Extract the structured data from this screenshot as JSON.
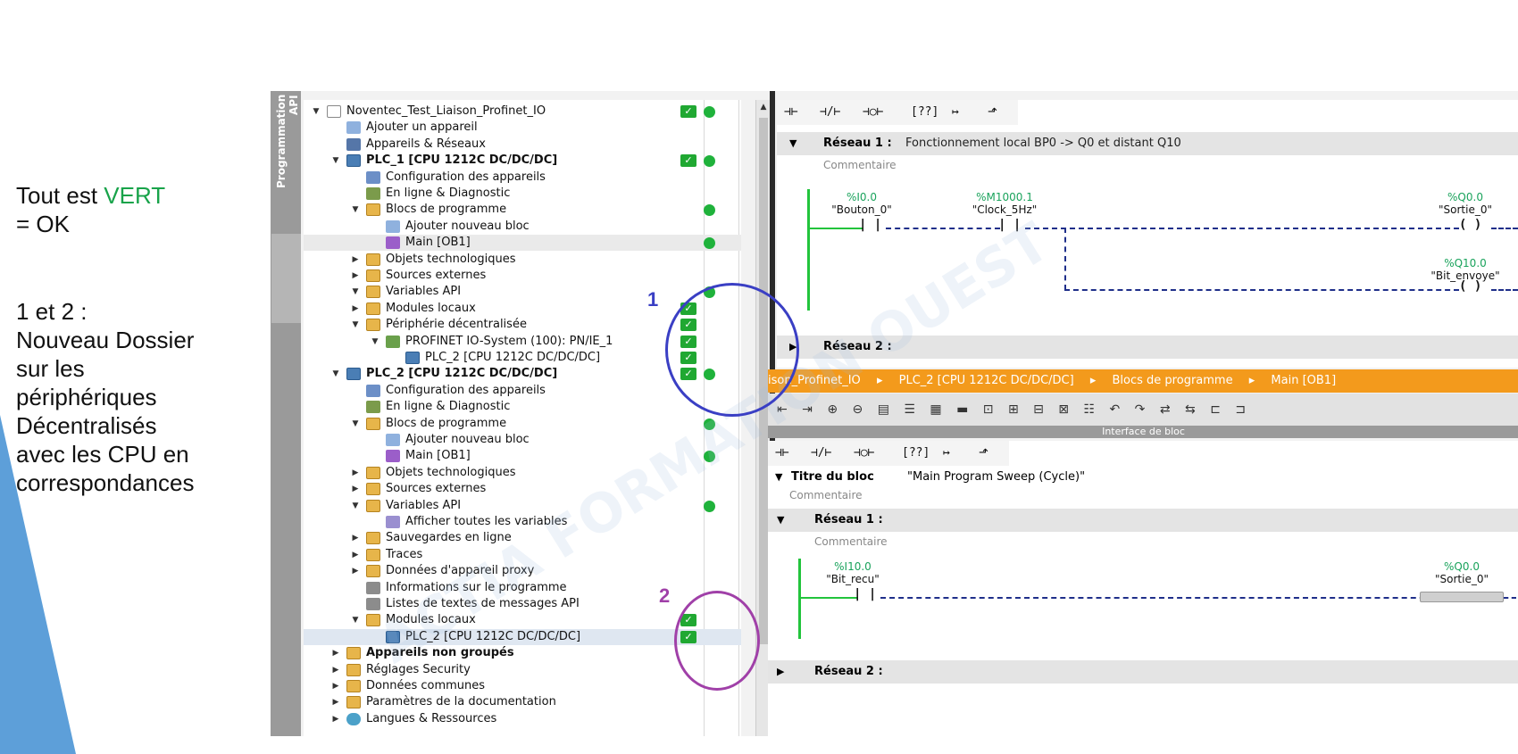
{
  "caption": {
    "line1_prefix": "Tout est ",
    "line1_highlight": "VERT",
    "line2": " = OK",
    "para_lines": [
      "1 et 2 :",
      "Nouveau Dossier",
      "sur les",
      "périphériques",
      "Décentralisés",
      "avec les CPU en",
      "correspondances"
    ]
  },
  "vertical_tab": "Programmation API",
  "tree": [
    {
      "label": "Noventec_Test_Liaison_Profinet_IO",
      "depth": 0,
      "exp": "open",
      "icon": "page",
      "check": true,
      "dot": true
    },
    {
      "label": "Ajouter un appareil",
      "depth": 1,
      "exp": "",
      "icon": "addblk"
    },
    {
      "label": "Appareils & Réseaux",
      "depth": 1,
      "exp": "",
      "icon": "net"
    },
    {
      "label": "PLC_1 [CPU 1212C DC/DC/DC]",
      "depth": 1,
      "exp": "open",
      "icon": "plc",
      "bold": true,
      "check": true,
      "dot": true
    },
    {
      "label": "Configuration des appareils",
      "depth": 2,
      "exp": "",
      "icon": "cfg"
    },
    {
      "label": "En ligne & Diagnostic",
      "depth": 2,
      "exp": "",
      "icon": "diag"
    },
    {
      "label": "Blocs de programme",
      "depth": 2,
      "exp": "open",
      "icon": "folder",
      "dot": true
    },
    {
      "label": "Ajouter nouveau bloc",
      "depth": 3,
      "exp": "",
      "icon": "addblk"
    },
    {
      "label": "Main [OB1]",
      "depth": 3,
      "exp": "",
      "icon": "main",
      "dot": true,
      "hl": true
    },
    {
      "label": "Objets technologiques",
      "depth": 2,
      "exp": "closed",
      "icon": "folder"
    },
    {
      "label": "Sources externes",
      "depth": 2,
      "exp": "closed",
      "icon": "folder"
    },
    {
      "label": "Variables API",
      "depth": 2,
      "exp": "open",
      "icon": "folder",
      "dot": true
    },
    {
      "label": "Modules locaux",
      "depth": 2,
      "exp": "closed",
      "icon": "folder",
      "check": true
    },
    {
      "label": "Périphérie décentralisée",
      "depth": 2,
      "exp": "open",
      "icon": "folder",
      "check": true
    },
    {
      "label": "PROFINET IO-System (100): PN/IE_1",
      "depth": 3,
      "exp": "open",
      "icon": "io",
      "check": true
    },
    {
      "label": "PLC_2 [CPU 1212C DC/DC/DC]",
      "depth": 4,
      "exp": "",
      "icon": "plc",
      "check": true
    },
    {
      "label": "PLC_2 [CPU 1212C DC/DC/DC]",
      "depth": 1,
      "exp": "open",
      "icon": "plc",
      "bold": true,
      "check": true,
      "dot": true
    },
    {
      "label": "Configuration des appareils",
      "depth": 2,
      "exp": "",
      "icon": "cfg"
    },
    {
      "label": "En ligne & Diagnostic",
      "depth": 2,
      "exp": "",
      "icon": "diag"
    },
    {
      "label": "Blocs de programme",
      "depth": 2,
      "exp": "open",
      "icon": "folder",
      "dot": true
    },
    {
      "label": "Ajouter nouveau bloc",
      "depth": 3,
      "exp": "",
      "icon": "addblk"
    },
    {
      "label": "Main [OB1]",
      "depth": 3,
      "exp": "",
      "icon": "main",
      "dot": true
    },
    {
      "label": "Objets technologiques",
      "depth": 2,
      "exp": "closed",
      "icon": "folder"
    },
    {
      "label": "Sources externes",
      "depth": 2,
      "exp": "closed",
      "icon": "folder"
    },
    {
      "label": "Variables API",
      "depth": 2,
      "exp": "open",
      "icon": "folder",
      "dot": true
    },
    {
      "label": "Afficher toutes les variables",
      "depth": 3,
      "exp": "",
      "icon": "vars"
    },
    {
      "label": "Sauvegardes en ligne",
      "depth": 2,
      "exp": "closed",
      "icon": "folder"
    },
    {
      "label": "Traces",
      "depth": 2,
      "exp": "closed",
      "icon": "folder"
    },
    {
      "label": "Données d'appareil proxy",
      "depth": 2,
      "exp": "closed",
      "icon": "folder"
    },
    {
      "label": "Informations sur le programme",
      "depth": 2,
      "exp": "",
      "icon": "info"
    },
    {
      "label": "Listes de textes de messages API",
      "depth": 2,
      "exp": "",
      "icon": "info"
    },
    {
      "label": "Modules locaux",
      "depth": 2,
      "exp": "open",
      "icon": "folder",
      "check": true
    },
    {
      "label": "PLC_2 [CPU 1212C DC/DC/DC]",
      "depth": 3,
      "exp": "",
      "icon": "plc",
      "check": true,
      "sel": true
    },
    {
      "label": "Appareils non groupés",
      "depth": 1,
      "exp": "closed",
      "icon": "folder",
      "bold": true
    },
    {
      "label": "Réglages Security",
      "depth": 1,
      "exp": "closed",
      "icon": "folder"
    },
    {
      "label": "Données communes",
      "depth": 1,
      "exp": "closed",
      "icon": "folder"
    },
    {
      "label": "Paramètres de la documentation",
      "depth": 1,
      "exp": "closed",
      "icon": "folder"
    },
    {
      "label": "Langues & Ressources",
      "depth": 1,
      "exp": "closed",
      "icon": "lang"
    }
  ],
  "ladder_toolbar": [
    "⊣⊢",
    "⊣/⊢",
    "⊣○⊢",
    "[??]",
    "↦",
    "⬏"
  ],
  "top_editor": {
    "network1_title": "Réseau 1 :",
    "network1_desc": "Fonctionnement local BP0 -> Q0 et distant Q10",
    "comment": "Commentaire",
    "contact1_addr": "%I0.0",
    "contact1_sym": "\"Bouton_0\"",
    "contact2_addr": "%M1000.1",
    "contact2_sym": "\"Clock_5Hz\"",
    "coil1_addr": "%Q0.0",
    "coil1_sym": "\"Sortie_0\"",
    "coil2_addr": "%Q10.0",
    "coil2_sym": "\"Bit_envoye\"",
    "network2_title": "Réseau 2 :"
  },
  "breadcrumb": [
    "ison_Profinet_IO",
    "▸",
    "PLC_2 [CPU 1212C DC/DC/DC]",
    "▸",
    "Blocs de programme",
    "▸",
    "Main [OB1]"
  ],
  "icon_bar": "⇤ ⇥ ⊕ ⊖ ▤ ☰ ▦ ▬ ⊡ ⊞ ⊟ ⊠ ☷ ↶ ↷ ⇄ ⇆ ⊏ ⊐",
  "interface_label": "Interface de bloc",
  "bottom_editor": {
    "title_label": "Titre du bloc",
    "title_value": "\"Main Program Sweep (Cycle)\"",
    "comment1": "Commentaire",
    "network1_title": "Réseau 1 :",
    "comment2": "Commentaire",
    "contact_addr": "%I10.0",
    "contact_sym": "\"Bit_recu\"",
    "coil_addr": "%Q0.0",
    "coil_sym": "\"Sortie_0\"",
    "network2_title": "Réseau 2 :"
  },
  "annotations": {
    "one": "1",
    "two": "2",
    "color_one": "#3a3fc4",
    "color_two": "#a040a8"
  },
  "colors": {
    "ok_green": "#1fb23b",
    "breadcrumb_orange": "#f39a1c"
  }
}
